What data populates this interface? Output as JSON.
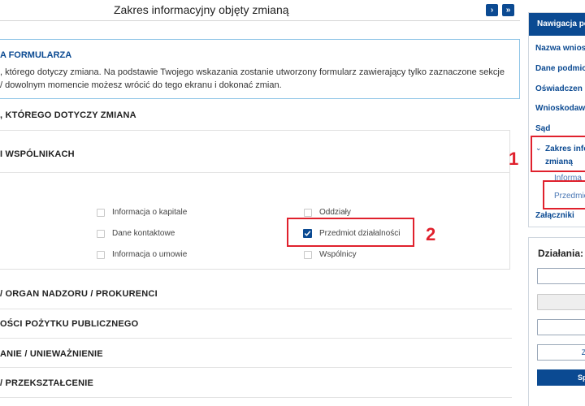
{
  "header": {
    "title": "Zakres informacyjny objęty zmianą",
    "next_btn": "›",
    "last_btn": "»"
  },
  "info": {
    "title": "A FORMULARZA",
    "line1": ", którego dotyczy zmiana. Na podstawie Twojego wskazania zostanie utworzony formularz zawierający tylko zaznaczone sekcje",
    "line2": "/ dowolnym momencie możesz wrócić do tego ekranu i dokonać zmian."
  },
  "sections": {
    "s1": ", KTÓREGO DOTYCZY ZMIANA",
    "s2": "I WSPÓLNIKACH",
    "s3": "/ ORGAN NADZORU / PROKURENCI",
    "s4": "OŚCI POŻYTKU PUBLICZNEGO",
    "s5": "ANIE / UNIEWAŻNIENIE",
    "s6": "/ PRZEKSZTAŁCENIE"
  },
  "checkboxes": [
    {
      "label": "Informacja o kapitale",
      "checked": false
    },
    {
      "label": "Dane kontaktowe",
      "checked": false
    },
    {
      "label": "Informacja o umowie",
      "checked": false
    },
    {
      "label": "Oddziały",
      "checked": false
    },
    {
      "label": "Przedmiot działalności",
      "checked": true
    },
    {
      "label": "Wspólnicy",
      "checked": false
    }
  ],
  "annotations": {
    "one": "1",
    "two": "2",
    "color": "#e0212d"
  },
  "nav": {
    "heading": "Nawigacja po",
    "items": [
      "Nazwa wnios",
      "Dane podmio",
      "Oświadczen",
      "Wnioskodaw",
      "Sąd"
    ],
    "active_line1": "Zakres info",
    "active_line2": "zmianą",
    "sub1": "Informa",
    "sub2": "Przedmio",
    "last": "Załączniki"
  },
  "actions": {
    "title": "Działania:",
    "btn_outline": "Za",
    "btn_primary": "Sp"
  },
  "colors": {
    "brand": "#0b4a92",
    "info_border": "#8cc3e6"
  }
}
